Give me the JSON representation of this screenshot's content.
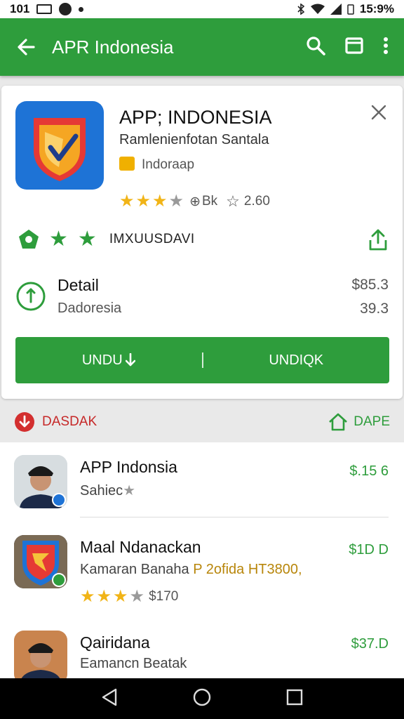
{
  "status_bar": {
    "left_text": "101",
    "time": "15:9%"
  },
  "app_bar": {
    "title": "APR Indonesia",
    "icons": [
      "back-arrow-icon",
      "search-icon",
      "window-icon",
      "more-vert-icon"
    ]
  },
  "app_card": {
    "title": "APP; INDONESIA",
    "subtitle": "Ramlenienfotan Santala",
    "developer": "Indoraap",
    "rating_stars": 3,
    "rating_count": "Bk",
    "reviews": "2.60",
    "badge_label": "IMXUUSDAVI",
    "detail_title": "Detail",
    "detail_sub": "Dadoresia",
    "price_top": "$85.3",
    "price_bottom": "39.3",
    "install_left": "UNDU",
    "install_right": "UNDIQK"
  },
  "section": {
    "left_label": "DASDAK",
    "right_label": "DAPE"
  },
  "list": [
    {
      "title": "APP Indonsia",
      "subtitle": "Sahiec",
      "price": "$.15 6"
    },
    {
      "title": "Maal Ndanackan",
      "subtitle": "Kamaran Banaha",
      "subtitle_accent": "P 2ofida HT3800,",
      "price": "$1D D",
      "rating_text": "$170",
      "rating_stars": 3
    },
    {
      "title": "Qairidana",
      "subtitle": "Eamancn Beatak",
      "price": "$37.D"
    }
  ],
  "colors": {
    "primary": "#2e9d3c",
    "accent_red": "#c62828",
    "star": "#f1b417"
  }
}
